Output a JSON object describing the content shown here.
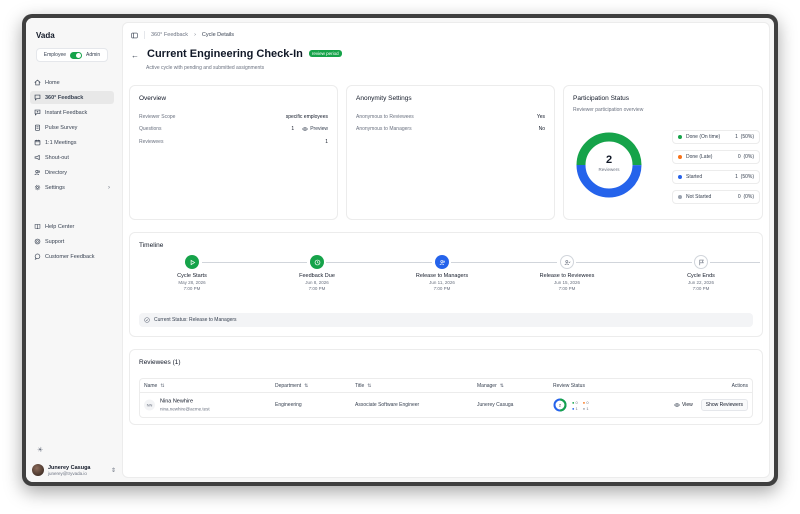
{
  "sidebar": {
    "brand": "Vada",
    "mode": {
      "left": "Employee",
      "right": "Admin"
    },
    "nav": [
      {
        "label": "Home",
        "icon": "home-icon"
      },
      {
        "label": "360° Feedback",
        "icon": "message-square-icon",
        "active": true
      },
      {
        "label": "Instant Feedback",
        "icon": "message-plus-icon"
      },
      {
        "label": "Pulse Survey",
        "icon": "clipboard-icon"
      },
      {
        "label": "1:1 Meetings",
        "icon": "calendar-icon"
      },
      {
        "label": "Shout-out",
        "icon": "megaphone-icon"
      },
      {
        "label": "Directory",
        "icon": "users-icon"
      },
      {
        "label": "Settings",
        "icon": "gear-icon"
      }
    ],
    "secondary": [
      {
        "label": "Help Center",
        "icon": "book-icon"
      },
      {
        "label": "Support",
        "icon": "support-icon"
      },
      {
        "label": "Customer Feedback",
        "icon": "chat-icon"
      }
    ],
    "user": {
      "name": "Junerey Casuga",
      "email": "junerey@tryvada.io"
    }
  },
  "breadcrumb": {
    "parent": "360° Feedback",
    "current": "Cycle Details"
  },
  "page": {
    "title": "Current Engineering Check-In",
    "badge": "review period",
    "subtitle": "Active cycle with pending and submitted assignments"
  },
  "overview": {
    "title": "Overview",
    "rows": [
      {
        "label": "Reviewer Scope",
        "value": "specific employees"
      },
      {
        "label": "Questions",
        "value": "1",
        "action": "Preview"
      },
      {
        "label": "Reviewees",
        "value": "1"
      }
    ]
  },
  "anonymity": {
    "title": "Anonymity Settings",
    "rows": [
      {
        "label": "Anonymous to Reviewees",
        "value": "Yes"
      },
      {
        "label": "Anonymous to Managers",
        "value": "No"
      }
    ]
  },
  "participation": {
    "title": "Participation Status",
    "subtitle": "Reviewer participation overview",
    "center_value": "2",
    "center_label": "Reviewers",
    "legend": [
      {
        "label": "Done (On time)",
        "count": "1",
        "pct": "(50%)",
        "color": "#16a34a",
        "fraction": 0.5
      },
      {
        "label": "Done (Late)",
        "count": "0",
        "pct": "(0%)",
        "color": "#f97316",
        "fraction": 0
      },
      {
        "label": "Started",
        "count": "1",
        "pct": "(50%)",
        "color": "#2563eb",
        "fraction": 0.5
      },
      {
        "label": "Not Started",
        "count": "0",
        "pct": "(0%)",
        "color": "#9ca3af",
        "fraction": 0
      }
    ]
  },
  "timeline": {
    "title": "Timeline",
    "steps": [
      {
        "label": "Cycle Starts",
        "date": "May 28, 2026",
        "time": "7:00 PM",
        "state": "done",
        "icon": "play-icon"
      },
      {
        "label": "Feedback Due",
        "date": "Jun 8, 2026",
        "time": "7:00 PM",
        "state": "done",
        "icon": "clock-icon"
      },
      {
        "label": "Release to Managers",
        "date": "Jun 11, 2026",
        "time": "7:00 PM",
        "state": "current",
        "icon": "users-icon"
      },
      {
        "label": "Release to Reviewees",
        "date": "Jun 15, 2026",
        "time": "7:00 PM",
        "state": "pending",
        "icon": "user-check-icon"
      },
      {
        "label": "Cycle Ends",
        "date": "Jun 22, 2026",
        "time": "7:00 PM",
        "state": "pending",
        "icon": "flag-icon"
      }
    ],
    "status_label": "Current Status: Release to Managers"
  },
  "reviewees": {
    "title": "Reviewees (1)",
    "columns": [
      "Name",
      "Department",
      "Title",
      "Manager",
      "Review Status",
      "Actions"
    ],
    "rows": [
      {
        "initials": "NN",
        "name": "Nina Newhire",
        "email": "nina.newhire@acme.test",
        "department": "Engineering",
        "title": "Associate Software Engineer",
        "manager": "Junerey Casuga",
        "status_counts": [
          "0",
          "0",
          "1",
          "1"
        ],
        "view_label": "View",
        "reviewers_label": "Show Reviewers"
      }
    ]
  }
}
